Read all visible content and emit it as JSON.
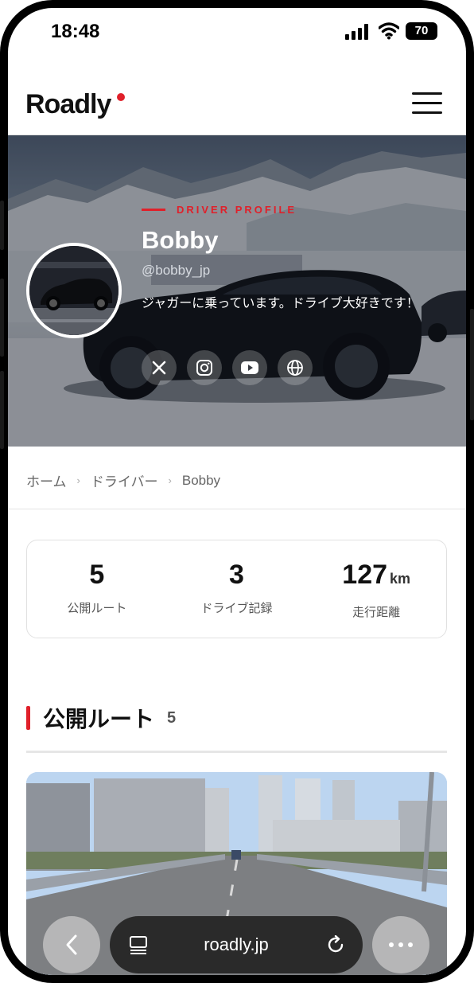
{
  "status_bar": {
    "time": "18:48",
    "battery": "70"
  },
  "header": {
    "logo": "Roadly",
    "menu_icon": "hamburger-icon"
  },
  "hero": {
    "eyebrow": "DRIVER PROFILE",
    "name": "Bobby",
    "handle": "@bobby_jp",
    "bio": "ジャガーに乗っています。ドライブ大好きです！",
    "socials": [
      "x-icon",
      "instagram-icon",
      "youtube-icon",
      "globe-icon"
    ]
  },
  "breadcrumb": {
    "home": "ホーム",
    "drivers": "ドライバー",
    "current": "Bobby"
  },
  "stats": [
    {
      "value": "5",
      "unit": "",
      "label": "公開ルート"
    },
    {
      "value": "3",
      "unit": "",
      "label": "ドライブ記録"
    },
    {
      "value": "127",
      "unit": "km",
      "label": "走行距離"
    }
  ],
  "section": {
    "title": "公開ルート",
    "count": "5"
  },
  "browser": {
    "url": "roadly.jp"
  },
  "colors": {
    "accent": "#e0202a"
  }
}
